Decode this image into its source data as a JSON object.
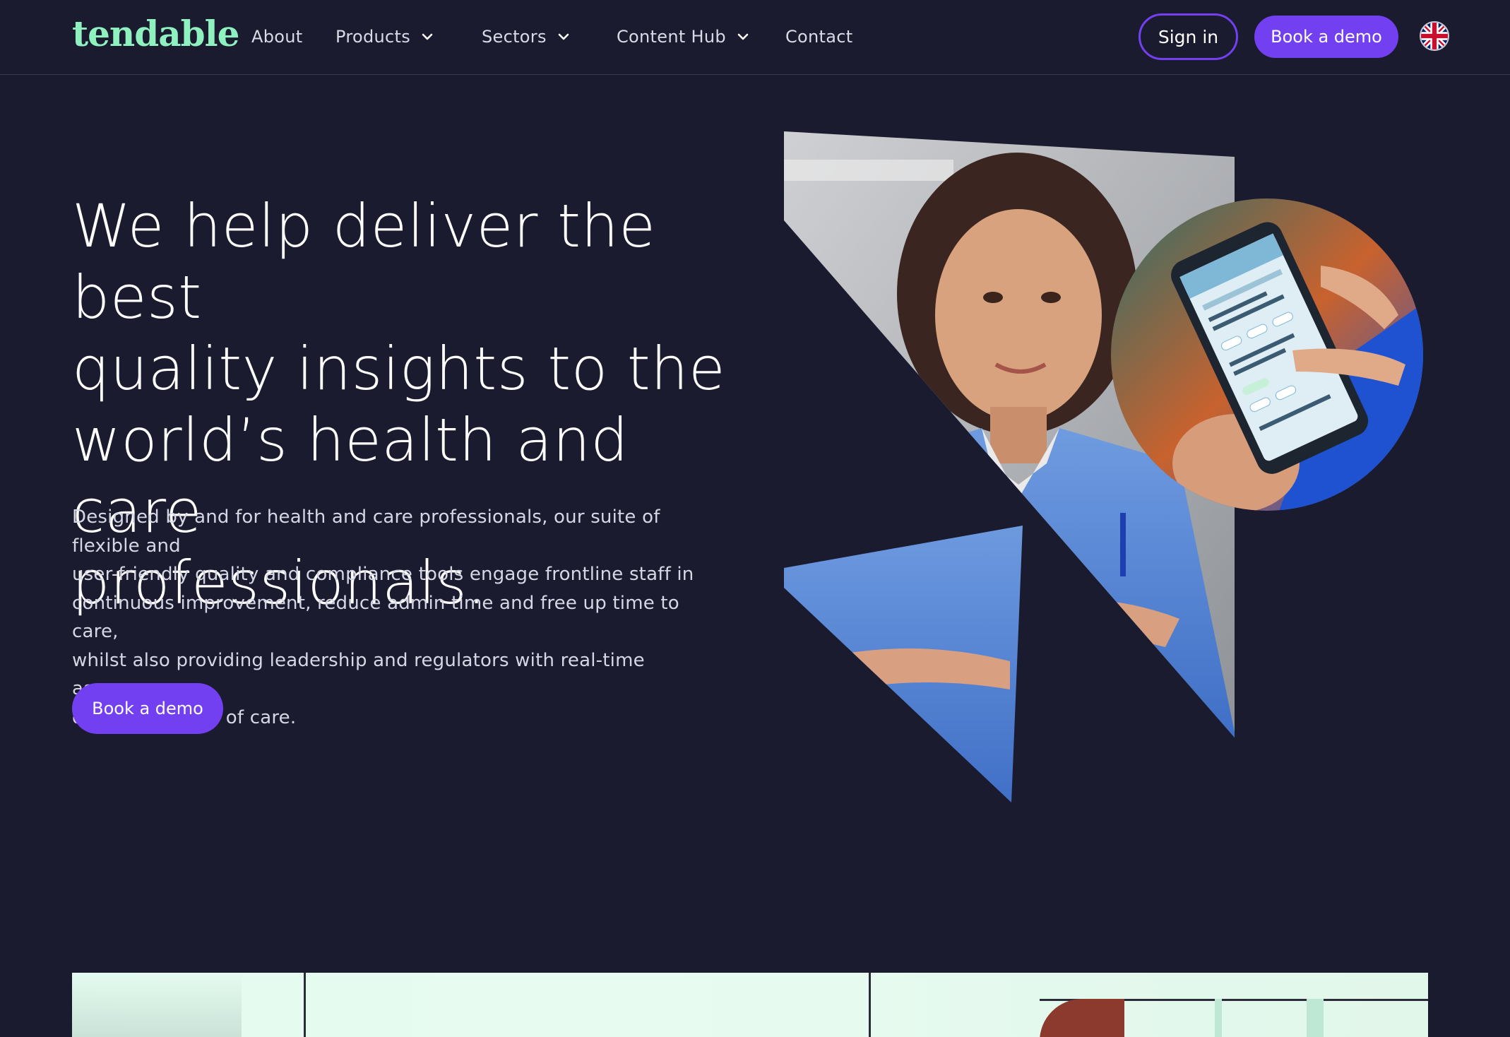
{
  "brand": {
    "logo_text": "tendable",
    "accent": "#7240f0",
    "logo_color": "#8ff0c0",
    "background": "#1a1b2e"
  },
  "nav": {
    "about": "About",
    "products": "Products",
    "sectors": "Sectors",
    "content_hub": "Content Hub",
    "contact": "Contact"
  },
  "header_actions": {
    "sign_in": "Sign in",
    "book_demo": "Book a demo",
    "language_icon": "uk-flag-icon"
  },
  "hero": {
    "title_lines": [
      "We help deliver the best",
      "quality insights to the",
      "world’s health and care",
      "professionals."
    ],
    "subtitle_lines": [
      "Designed by and for health and care professionals, our suite of flexible and",
      "user-friendly quality and compliance tools engage frontline staff in",
      "continuous improvement, reduce admin time and free up time to care,",
      "whilst also providing leadership and regulators with real-time assurance",
      "over the quality of care."
    ],
    "cta": "Book a demo"
  }
}
